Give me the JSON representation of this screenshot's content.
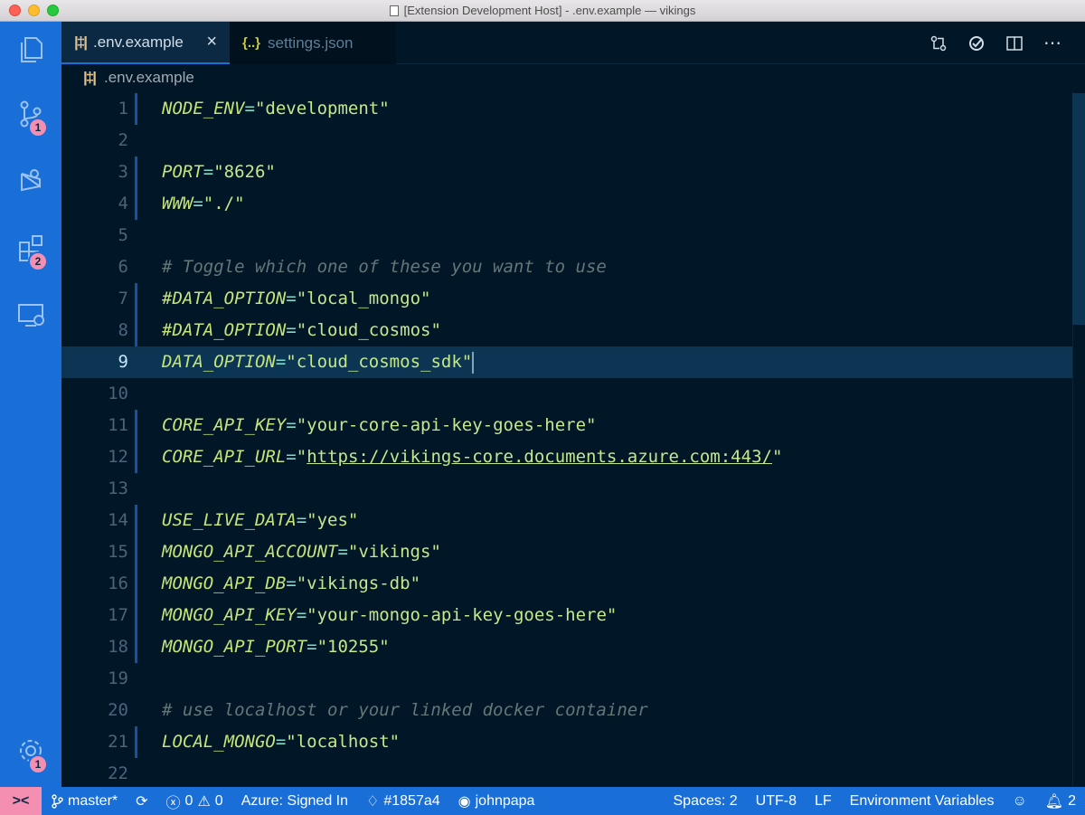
{
  "window": {
    "title": "[Extension Development Host] - .env.example — vikings"
  },
  "activity": {
    "badges": {
      "scm": "1",
      "extensions": "2",
      "settings": "1"
    }
  },
  "tabs": [
    {
      "label": ".env.example",
      "icon": "settings-sliders-icon",
      "active": true
    },
    {
      "label": "settings.json",
      "icon": "json-braces-icon",
      "active": false
    }
  ],
  "breadcrumb": {
    "file": ".env.example"
  },
  "editor": {
    "current_line": 9,
    "lines": [
      {
        "n": "1",
        "key": "NODE_ENV",
        "val": "\"development\""
      },
      {
        "n": "2"
      },
      {
        "n": "3",
        "key": "PORT",
        "val": "\"8626\""
      },
      {
        "n": "4",
        "key": "WWW",
        "val": "\"./\""
      },
      {
        "n": "5"
      },
      {
        "n": "6",
        "comment": "# Toggle which one of these you want to use"
      },
      {
        "n": "7",
        "key": "#DATA_OPTION",
        "val": "\"local_mongo\""
      },
      {
        "n": "8",
        "key": "#DATA_OPTION",
        "val": "\"cloud_cosmos\""
      },
      {
        "n": "9",
        "key": "DATA_OPTION",
        "val": "\"cloud_cosmos_sdk\""
      },
      {
        "n": "10"
      },
      {
        "n": "11",
        "key": "CORE_API_KEY",
        "val": "\"your-core-api-key-goes-here\""
      },
      {
        "n": "12",
        "key": "CORE_API_URL",
        "url": "https://vikings-core.documents.azure.com:443/"
      },
      {
        "n": "13"
      },
      {
        "n": "14",
        "key": "USE_LIVE_DATA",
        "val": "\"yes\""
      },
      {
        "n": "15",
        "key": "MONGO_API_ACCOUNT",
        "val": "\"vikings\""
      },
      {
        "n": "16",
        "key": "MONGO_API_DB",
        "val": "\"vikings-db\""
      },
      {
        "n": "17",
        "key": "MONGO_API_KEY",
        "val": "\"your-mongo-api-key-goes-here\""
      },
      {
        "n": "18",
        "key": "MONGO_API_PORT",
        "val": "\"10255\""
      },
      {
        "n": "19"
      },
      {
        "n": "20",
        "comment": "# use localhost or your linked docker container"
      },
      {
        "n": "21",
        "key": "LOCAL_MONGO",
        "val": "\"localhost\""
      },
      {
        "n": "22"
      }
    ]
  },
  "statusbar": {
    "branch": "master*",
    "errors": "0",
    "warnings": "0",
    "azure": "Azure: Signed In",
    "color": "#1857a4",
    "user": "johnpapa",
    "spaces": "Spaces: 2",
    "encoding": "UTF-8",
    "eol": "LF",
    "language": "Environment Variables",
    "notifications": "2"
  },
  "colors": {
    "accent": "#1a6ed8",
    "editor_bg": "#011627",
    "badge": "#f48fb1"
  }
}
